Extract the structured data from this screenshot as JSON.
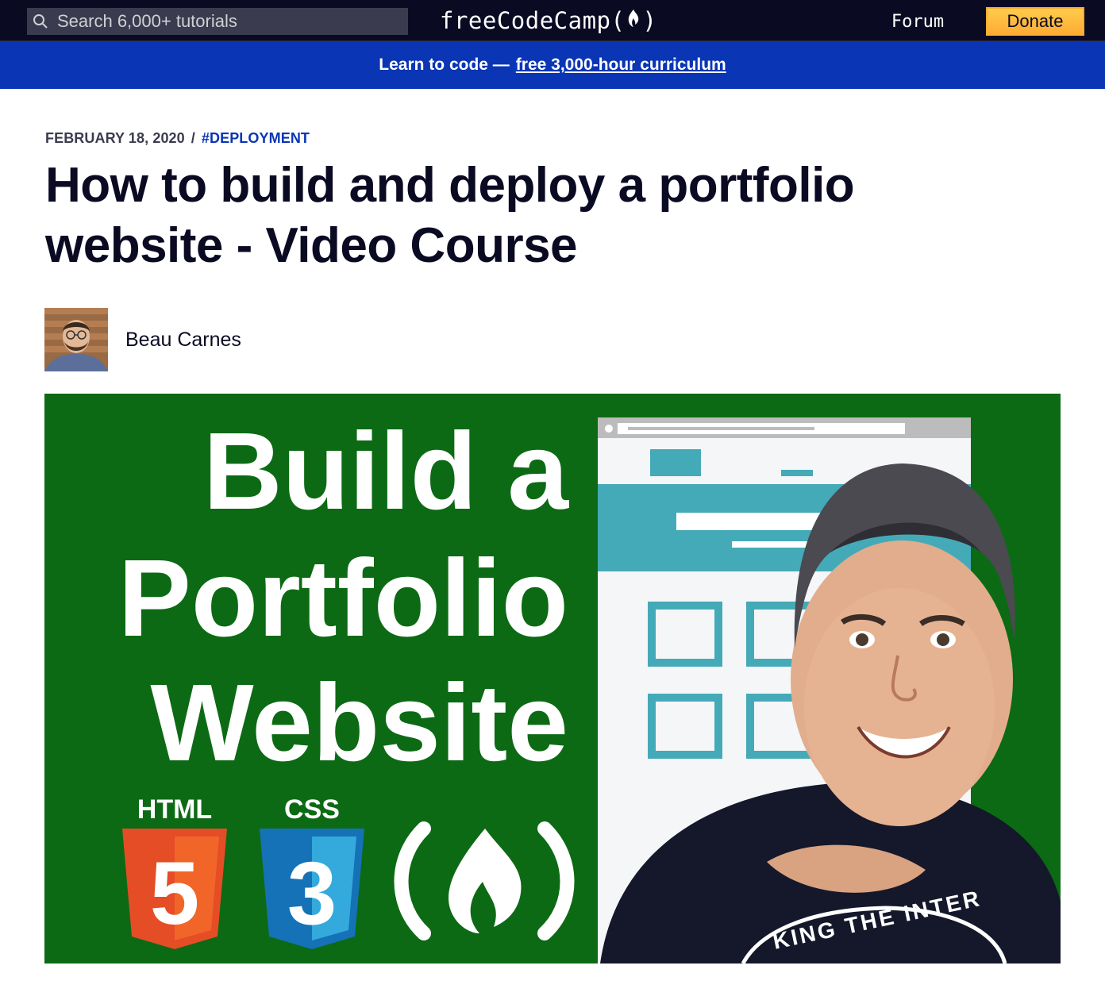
{
  "nav": {
    "search_placeholder": "Search 6,000+ tutorials",
    "brand": "freeCodeCamp(",
    "brand_close": ")",
    "forum_label": "Forum",
    "donate_label": "Donate"
  },
  "banner": {
    "text": "Learn to code —",
    "link_text": "free 3,000-hour curriculum"
  },
  "article": {
    "date": "FEBRUARY 18, 2020",
    "separator": "/",
    "tag": "#DEPLOYMENT",
    "title": "How to build and deploy a portfolio website - Video Course",
    "author": "Beau Carnes"
  },
  "hero": {
    "line1": "Build a",
    "line2": "Portfolio",
    "line3": "Website",
    "html_label": "HTML",
    "css_label": "CSS",
    "html_number": "5",
    "css_number": "3",
    "shirt_text": "KING THE INTER"
  },
  "colors": {
    "nav_bg": "#0a0a23",
    "banner_bg": "#0a35b4",
    "donate_bg": "#feac32",
    "hero_green": "#0c6a14",
    "html_orange": "#e44d26",
    "css_blue": "#1572b6"
  }
}
